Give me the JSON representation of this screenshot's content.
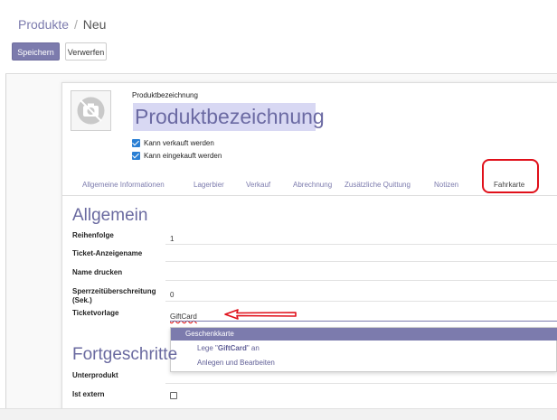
{
  "breadcrumb": {
    "parent": "Produkte",
    "separator": "/",
    "current": "Neu"
  },
  "buttons": {
    "save": "Speichern",
    "discard": "Verwerfen"
  },
  "product": {
    "name_label": "Produktbezeichnung",
    "name_value": "Produktbezeichnung",
    "can_be_sold": "Kann verkauft werden",
    "can_be_purchased": "Kann eingekauft werden"
  },
  "tabs": [
    "Allgemeine Informationen",
    "Lagerbier",
    "Verkauf",
    "Abrechnung",
    "Zusätzliche Quittung",
    "Notizen",
    "Fahrkarte"
  ],
  "general": {
    "title": "Allgemein",
    "fields": [
      {
        "label": "Reihenfolge",
        "value": "1"
      },
      {
        "label": "Ticket-Anzeigename",
        "value": ""
      },
      {
        "label": "Name drucken",
        "value": ""
      },
      {
        "label": "Sperrzeitüberschreitung (Sek.)",
        "value": "0"
      },
      {
        "label": "Ticketvorlage",
        "value": "GiftCard"
      }
    ]
  },
  "dropdown": {
    "options": [
      "Geschenkkarte",
      "Lege \" GiftCard \" an",
      "Anlegen und Bearbeiten"
    ],
    "create_prefix": "Lege \"",
    "create_term": "GiftCard",
    "create_suffix": "\" an"
  },
  "advanced": {
    "title": "Fortgeschritte",
    "fields": [
      {
        "label": "Unterprodukt",
        "value": ""
      },
      {
        "label": "Ist extern",
        "value": ""
      }
    ]
  },
  "colors": {
    "accent": "#7c7bad",
    "highlight": "#e0101a",
    "checkbox": "#2a7fd4"
  }
}
